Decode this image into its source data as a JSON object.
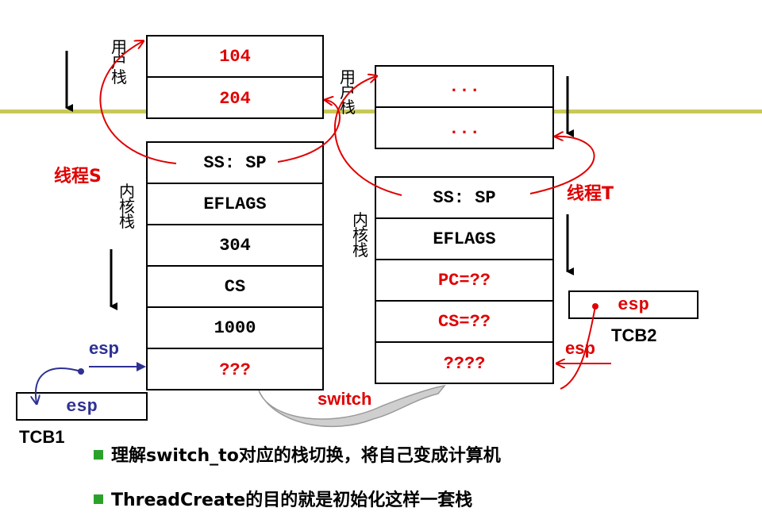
{
  "user_stack_label": "用户栈",
  "kernel_stack_label": "内核栈",
  "stack_s": {
    "thread_label": "线程S",
    "user_cells": [
      "104",
      "204"
    ],
    "kernel_cells": [
      "SS: SP",
      "EFLAGS",
      "304",
      "CS",
      "1000",
      "???"
    ]
  },
  "stack_t": {
    "thread_label": "线程T",
    "user_cells": [
      "...",
      "..."
    ],
    "kernel_cells": [
      "SS: SP",
      "EFLAGS",
      "PC=??",
      "CS=??",
      "????"
    ]
  },
  "tcb1": {
    "name": "TCB1",
    "field": "esp"
  },
  "tcb2": {
    "name": "TCB2",
    "field": "esp"
  },
  "esp_pointer_s": "esp",
  "esp_pointer_t": "esp",
  "switch_label": "switch",
  "bullets": [
    "理解switch_to对应的栈切换，将自己变成计算机",
    "ThreadCreate的目的就是初始化这样一套栈"
  ],
  "colors": {
    "accent_red": "#e00000",
    "accent_blue": "#2e3192",
    "bullet_green": "#2aa22a",
    "divider": "#c8c85a"
  }
}
